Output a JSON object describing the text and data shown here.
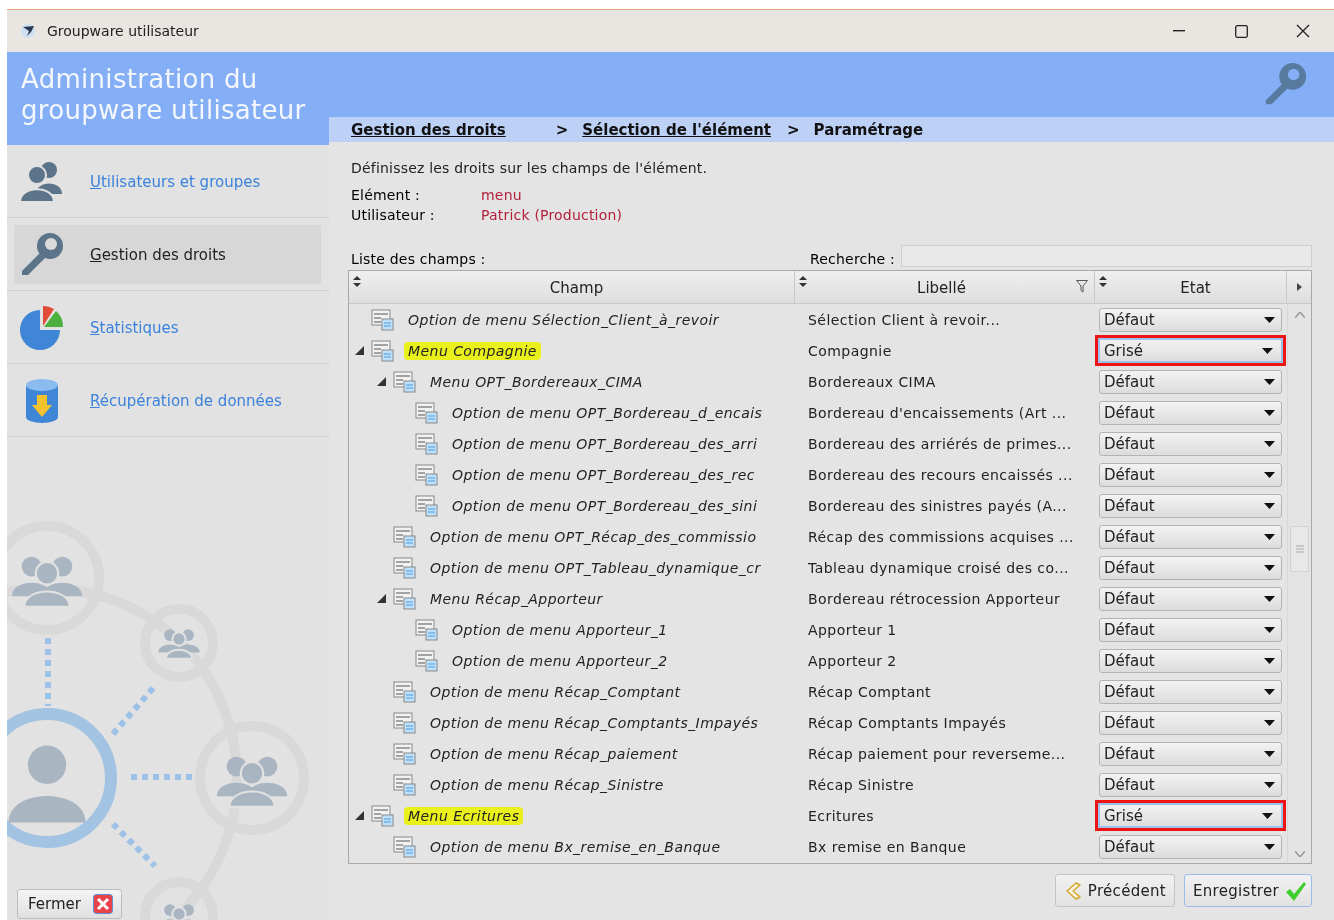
{
  "window": {
    "title": "Groupware utilisateur"
  },
  "sidebar": {
    "title": "Administration du groupware utilisateur",
    "items": [
      {
        "label": "Utilisateurs et groupes",
        "kind": "users",
        "selected": false
      },
      {
        "label": "Gestion des droits",
        "kind": "key",
        "selected": true
      },
      {
        "label": "Statistiques",
        "kind": "chart",
        "selected": false
      },
      {
        "label": "Récupération de données",
        "kind": "database",
        "selected": false
      }
    ],
    "close_button": "Fermer"
  },
  "breadcrumb": [
    {
      "label": "Gestion des droits",
      "kind": "link"
    },
    {
      "label": ">",
      "kind": "separator"
    },
    {
      "label": "Sélection de l'élément",
      "kind": "link"
    },
    {
      "label": ">",
      "kind": "separator"
    },
    {
      "label": "Paramétrage",
      "kind": "current"
    }
  ],
  "intro": "Définissez les droits sur les champs de l'élément.",
  "fields": [
    {
      "label": "Elément :",
      "value": "menu"
    },
    {
      "label": "Utilisateur :",
      "value": "Patrick (Production)"
    }
  ],
  "list_label": "Liste des champs :",
  "search": {
    "label": "Recherche :"
  },
  "table": {
    "columns": [
      {
        "label": "Champ",
        "filter": false
      },
      {
        "label": "Libellé",
        "filter": true
      },
      {
        "label": "Etat",
        "filter": false
      }
    ],
    "rows": [
      {
        "champ": "Option de menu Sélection_Client_à_revoir",
        "libelle": "Sélection Client à revoir...",
        "etat": "Défaut",
        "highlighted": false,
        "flagged": false
      },
      {
        "champ": "Menu Compagnie",
        "libelle": "Compagnie",
        "etat": "Grisé",
        "highlighted": true,
        "flagged": true,
        "expanded": true,
        "children": [
          {
            "champ": "Menu OPT_Bordereaux_CIMA",
            "libelle": "Bordereaux CIMA",
            "etat": "Défaut",
            "highlighted": false,
            "flagged": false,
            "expanded": true,
            "children": [
              {
                "champ": "Option de menu OPT_Bordereau_d_encais",
                "libelle": "Bordereau d'encaissements (Art ...",
                "etat": "Défaut",
                "highlighted": false,
                "flagged": false
              },
              {
                "champ": "Option de menu OPT_Bordereau_des_arri",
                "libelle": "Bordereau des arriérés de primes...",
                "etat": "Défaut",
                "highlighted": false,
                "flagged": false
              },
              {
                "champ": "Option de menu OPT_Bordereau_des_rec",
                "libelle": "Bordereau des recours encaissés ...",
                "etat": "Défaut",
                "highlighted": false,
                "flagged": false
              },
              {
                "champ": "Option de menu OPT_Bordereau_des_sini",
                "libelle": "Bordereau des sinistres payés (A...",
                "etat": "Défaut",
                "highlighted": false,
                "flagged": false
              }
            ]
          },
          {
            "champ": "Option de menu OPT_Récap_des_commissio",
            "libelle": "Récap des commissions acquises ...",
            "etat": "Défaut",
            "highlighted": false,
            "flagged": false
          },
          {
            "champ": "Option de menu OPT_Tableau_dynamique_cr",
            "libelle": "Tableau dynamique croisé des co...",
            "etat": "Défaut",
            "highlighted": false,
            "flagged": false
          },
          {
            "champ": "Menu Récap_Apporteur",
            "libelle": "Bordereau rétrocession Apporteur",
            "etat": "Défaut",
            "highlighted": false,
            "flagged": false,
            "expanded": true,
            "children": [
              {
                "champ": "Option de menu Apporteur_1",
                "libelle": "Apporteur 1",
                "etat": "Défaut",
                "highlighted": false,
                "flagged": false
              },
              {
                "champ": "Option de menu Apporteur_2",
                "libelle": "Apporteur 2",
                "etat": "Défaut",
                "highlighted": false,
                "flagged": false
              }
            ]
          },
          {
            "champ": "Option de menu Récap_Comptant",
            "libelle": "Récap Comptant",
            "etat": "Défaut",
            "highlighted": false,
            "flagged": false
          },
          {
            "champ": "Option de menu Récap_Comptants_Impayés",
            "libelle": "Récap Comptants Impayés",
            "etat": "Défaut",
            "highlighted": false,
            "flagged": false
          },
          {
            "champ": "Option de menu Récap_paiement",
            "libelle": "Récap paiement pour reverseme...",
            "etat": "Défaut",
            "highlighted": false,
            "flagged": false
          },
          {
            "champ": "Option de menu Récap_Sinistre",
            "libelle": "Récap Sinistre",
            "etat": "Défaut",
            "highlighted": false,
            "flagged": false
          }
        ]
      },
      {
        "champ": "Menu Ecritures",
        "libelle": "Ecritures",
        "etat": "Grisé",
        "highlighted": true,
        "flagged": true,
        "expanded": true,
        "children": [
          {
            "champ": "Option de menu Bx_remise_en_Banque",
            "libelle": "Bx remise en Banque",
            "etat": "Défaut",
            "highlighted": false,
            "flagged": false
          }
        ]
      }
    ]
  },
  "buttons": [
    {
      "label": "Précédent",
      "kind": "back"
    },
    {
      "label": "Enregistrer",
      "kind": "save"
    }
  ]
}
